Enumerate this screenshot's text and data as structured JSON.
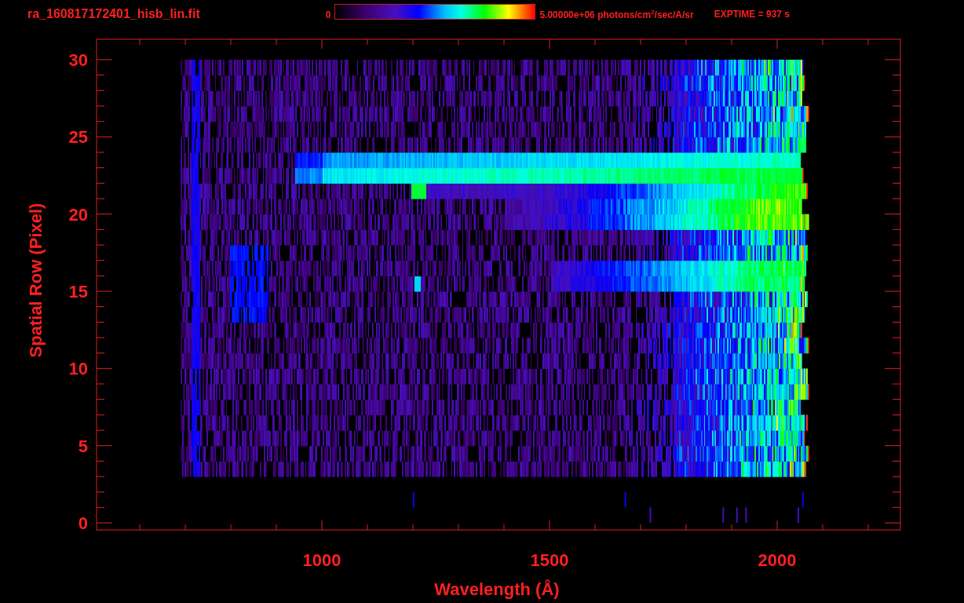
{
  "header": {
    "title": "ra_160817172401_hisb_lin.fit",
    "colorbar": {
      "min_label": "0",
      "max_label": "5.00000e+06 photons/cm$^{2}$/sec/A/sr"
    },
    "exposure": "EXPTIME = 937 s"
  },
  "plot": {
    "y_axis": {
      "title": "Spatial Row (Pixel)",
      "ticks": [
        "30",
        "25",
        "20",
        "15",
        "10",
        "5",
        "0"
      ]
    },
    "x_axis": {
      "title": "Wavelength (Å)",
      "ticks": [
        "1000",
        "1500",
        "2000"
      ]
    }
  }
}
